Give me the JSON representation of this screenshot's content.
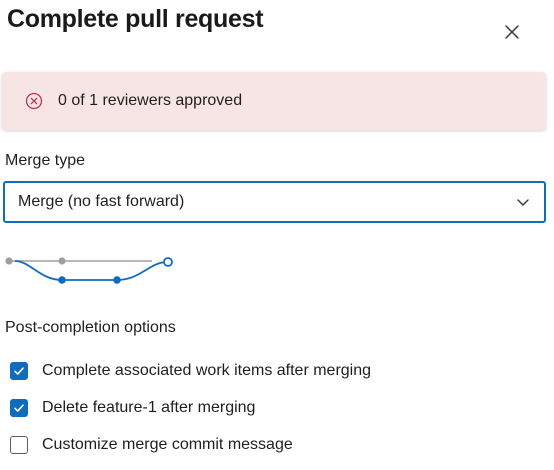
{
  "dialog": {
    "title": "Complete pull request",
    "close_icon": "close-icon"
  },
  "alert": {
    "icon": "error-circle-icon",
    "text": "0 of 1 reviewers approved",
    "icon_color": "#c4314b",
    "background": "#f7e5e5"
  },
  "merge_type": {
    "label": "Merge type",
    "selected": "Merge (no fast forward)",
    "chevron_icon": "chevron-down-icon"
  },
  "post_completion": {
    "label": "Post-completion options",
    "options": [
      {
        "label": "Complete associated work items after merging",
        "checked": true
      },
      {
        "label": "Delete feature-1 after merging",
        "checked": true
      },
      {
        "label": "Customize merge commit message",
        "checked": false
      }
    ]
  },
  "colors": {
    "accent": "#0f6cbd",
    "text": "#201f1e"
  }
}
